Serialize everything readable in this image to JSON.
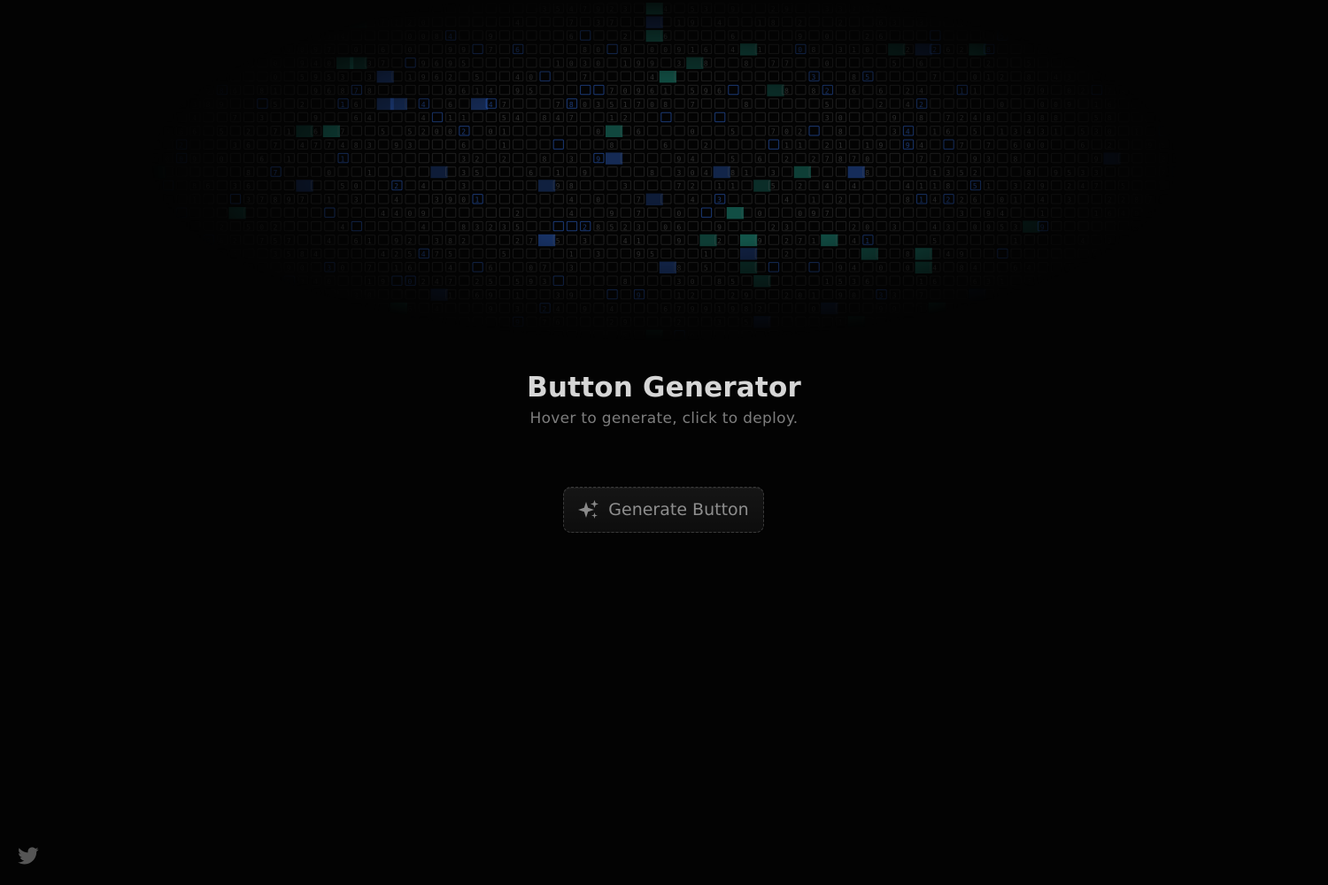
{
  "page": {
    "title": "Button Generator",
    "subtitle": "Hover to generate, click to deploy."
  },
  "button": {
    "label": "Generate Button",
    "icon": "sparkles-icon"
  },
  "footer": {
    "social_icon": "twitter-icon"
  },
  "colors": {
    "background": "#030303",
    "title": "#d6d6d6",
    "subtitle": "#7d7d7d",
    "button_text": "#8e8e8e",
    "matrix_teal": "#2ee6c8",
    "matrix_blue": "#3a7cff",
    "icon_gray": "#555555"
  }
}
